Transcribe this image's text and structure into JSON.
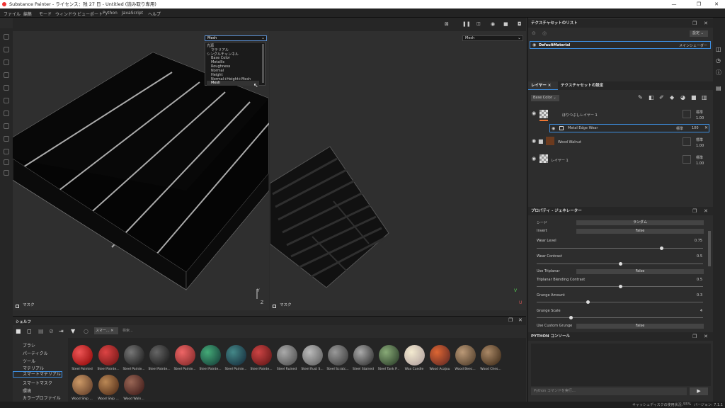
{
  "titlebar": {
    "title": "Substance Painter - ライセンス：残 27 日 - Untitled (読み取り専用)",
    "minimize": "—",
    "maximize": "❐",
    "close": "✕"
  },
  "menu": [
    "ファイル",
    "編集",
    "モード",
    "ウィンドウ",
    "ビューポート",
    "Python",
    "JavaScript",
    "ヘルプ"
  ],
  "viewport_left": {
    "dropdown": "Mesh",
    "options": [
      "光源",
      "マテリアル",
      "シングルチャンネル",
      "Base Color",
      "Metallic",
      "Roughness",
      "Normal",
      "Height",
      "Normal+Height+Mesh",
      "Mesh"
    ],
    "label": "マスク"
  },
  "viewport_right": {
    "dropdown": "Mesh",
    "label": "マスク"
  },
  "texture_sets": {
    "title": "テクスチャセットのリスト",
    "settings": "設定",
    "item": "DefaultMaterial",
    "shader": "メインシェーダー"
  },
  "layers": {
    "tab1": "レイヤー",
    "tab2": "テクスチャセットの設定",
    "channel": "Base Color",
    "rows": [
      {
        "name": "ほりつぶしレイヤー 1",
        "blend": "標準",
        "opacity": "1.00"
      },
      {
        "name": "Metal Edge Wear",
        "blend": "標準",
        "opacity": "100"
      },
      {
        "name": "Wood Walnut",
        "blend": "標準",
        "opacity": "1.00"
      },
      {
        "name": "レイヤー 1",
        "blend": "標準",
        "opacity": "1.00"
      }
    ]
  },
  "properties": {
    "title": "プロパティ - ジェネレーター",
    "seed_label": "シード",
    "seed_value": "ランダム",
    "invert_label": "Invert",
    "invert_value": "False",
    "wear_level": "Wear Level",
    "wear_level_val": "0.75",
    "wear_contrast": "Wear Contrast",
    "wear_contrast_val": "0.5",
    "use_triplanar": "Use Triplanar",
    "use_triplanar_val": "False",
    "tbc": "Triplanar Blending Contrast",
    "tbc_val": "0.5",
    "grunge_amount": "Grunge Amount",
    "grunge_amount_val": "0.3",
    "grunge_scale": "Grunge Scale",
    "grunge_scale_val": "4",
    "use_custom": "Use Custom Grunge",
    "use_custom_val": "False"
  },
  "python": {
    "title": "PYTHON コンソール",
    "placeholder": "Python コマンドを実行…"
  },
  "shelf": {
    "title": "シェルフ",
    "search_placeholder": "検索...",
    "filter_tag": "スマー...",
    "categories": [
      "ブラシ",
      "パーティクル",
      "ツール",
      "マテリアル",
      "スマートマテリアル",
      "スマートマスク",
      "環境",
      "カラープロファイル"
    ],
    "row1": [
      "Steel Painted",
      "Steel Painte...",
      "Steel Painte...",
      "Steel Painte...",
      "Steel Painte...",
      "Steel Painte...",
      "Steel Painte...",
      "Steel Painte...",
      "Steel Ruined",
      "Steel Rust S...",
      "Steel Scratc...",
      "Steel Stained",
      "Steel Tank P...",
      "Wax Candle",
      "Wood Acajou",
      "Wood Beec...",
      "Wood Ches..."
    ],
    "row2": [
      "Wood Ship ...",
      "Wood Ship ...",
      "Wood Waln..."
    ]
  },
  "status": {
    "cache": "キャッシュディスクの使用状況:",
    "pct": "55%",
    "version": "バージョン: 7.1.1"
  },
  "colors": {
    "accent": "#3d8ee0",
    "highlight": "#ffffff"
  }
}
